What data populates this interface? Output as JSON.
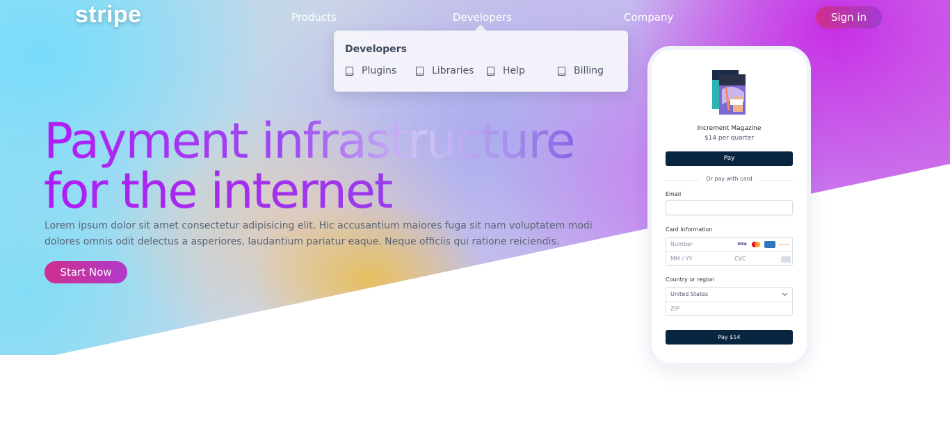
{
  "brand": {
    "logo_text": "stripe"
  },
  "nav": {
    "products": "Products",
    "developers": "Developers",
    "company": "Company",
    "sign_in": "Sign in"
  },
  "dropdown": {
    "title": "Developers",
    "items": [
      {
        "label": "Plugins",
        "icon": "book-icon"
      },
      {
        "label": "Libraries",
        "icon": "book-icon"
      },
      {
        "label": "Help",
        "icon": "book-icon"
      },
      {
        "label": "Billing",
        "icon": "book-icon"
      }
    ]
  },
  "hero": {
    "headline_line1": "Payment infrastructure",
    "headline_line2": "for the internet",
    "description": "Lorem ipsum dolor sit amet consectetur adipisicing elit. Hic accusantium maiores fuga sit nam voluptatem modi dolores omnis odit delectus a asperiores, laudantium pariatur eaque. Neque officiis qui ratione reiciendis.",
    "cta": "Start Now"
  },
  "checkout": {
    "product_name": "Increment Magazine",
    "price": "$14 per quarter",
    "apple_pay": " Pay",
    "divider": "Or pay with card",
    "email_label": "Email",
    "email_value": "",
    "card_label": "Card Information",
    "card_number_placeholder": "Number",
    "card_logos": [
      "VISA",
      "MC",
      "AMEX",
      "DISCOVER"
    ],
    "expiry_placeholder": "MM / YY",
    "cvc_placeholder": "CVC",
    "country_label": "Country or region",
    "country_value": "United States",
    "zip_placeholder": "ZIP",
    "pay_button": "Pay $14"
  },
  "colors": {
    "accent_pink": "#cf2f8e",
    "accent_purple": "#a23bd2",
    "checkout_button": "#0a2540",
    "headline_purple": "#b11bf5"
  }
}
